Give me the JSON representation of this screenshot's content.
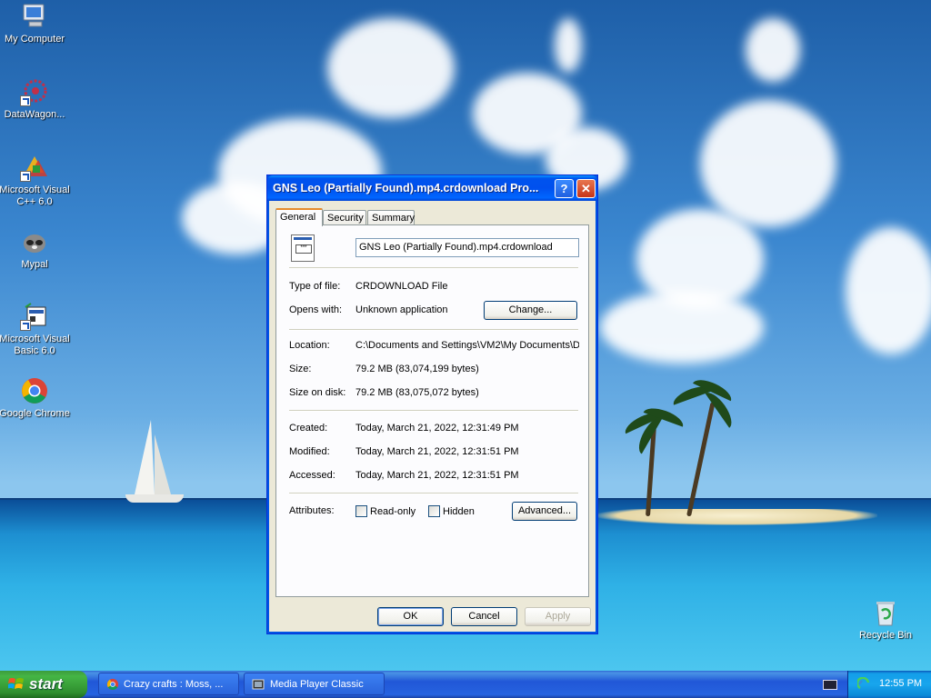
{
  "desktop": {
    "icons": [
      {
        "label": "My Computer"
      },
      {
        "label": "DataWagon..."
      },
      {
        "label": "Microsoft Visual C++ 6.0"
      },
      {
        "label": "Mypal"
      },
      {
        "label": "Microsoft Visual Basic 6.0"
      },
      {
        "label": "Google Chrome"
      },
      {
        "label": "Recycle Bin"
      }
    ]
  },
  "dialog": {
    "title": "GNS Leo (Partially Found).mp4.crdownload Pro...",
    "help_label": "?",
    "close_label": "✕",
    "tabs": [
      {
        "label": "General",
        "active": true
      },
      {
        "label": "Security",
        "active": false
      },
      {
        "label": "Summary",
        "active": false
      }
    ],
    "file_icon_text": "***",
    "file_name": "GNS Leo (Partially Found).mp4.crdownload",
    "type_label": "Type of file:",
    "type_value": "CRDOWNLOAD File",
    "opens_label": "Opens with:",
    "opens_value": "Unknown application",
    "change_label": "Change...",
    "location_label": "Location:",
    "location_value": "C:\\Documents and Settings\\VM2\\My Documents\\D",
    "size_label": "Size:",
    "size_value": "79.2 MB (83,074,199 bytes)",
    "size_on_disk_label": "Size on disk:",
    "size_on_disk_value": "79.2 MB (83,075,072 bytes)",
    "created_label": "Created:",
    "created_value": "Today, March 21, 2022, 12:31:49 PM",
    "modified_label": "Modified:",
    "modified_value": "Today, March 21, 2022, 12:31:51 PM",
    "accessed_label": "Accessed:",
    "accessed_value": "Today, March 21, 2022, 12:31:51 PM",
    "attributes_label": "Attributes:",
    "readonly_label": "Read-only",
    "hidden_label": "Hidden",
    "advanced_label": "Advanced...",
    "ok_label": "OK",
    "cancel_label": "Cancel",
    "apply_label": "Apply"
  },
  "taskbar": {
    "start_label": "start",
    "tasks": [
      {
        "label": "Crazy crafts : Moss, ..."
      },
      {
        "label": "Media Player Classic"
      }
    ],
    "clock": "12:55 PM"
  },
  "colors": {
    "titlebar": "#0053ee",
    "dialog_bg": "#ece9d8",
    "taskbar": "#2157d7",
    "start_green": "#3c9b3c"
  }
}
